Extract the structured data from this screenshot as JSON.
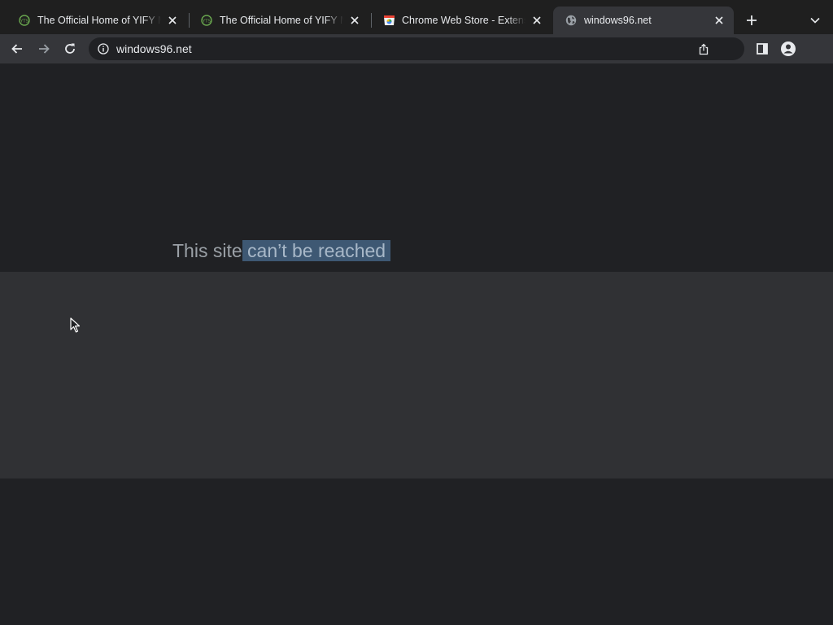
{
  "tabs": [
    {
      "title": "The Official Home of YIFY Movies",
      "favicon": "yify-icon",
      "active": false
    },
    {
      "title": "The Official Home of YIFY Movies",
      "favicon": "yify-icon",
      "active": false
    },
    {
      "title": "Chrome Web Store - Extensions",
      "favicon": "chrome-web-store-icon",
      "active": false
    },
    {
      "title": "windows96.net",
      "favicon": "globe-icon",
      "active": true
    }
  ],
  "omnibox": {
    "url": "windows96.net"
  },
  "error_page": {
    "heading_part1": "This site",
    "heading_part2": " can’t be reached"
  },
  "colors": {
    "selection": "#3e5873",
    "band": "#303134",
    "background": "#202124"
  }
}
